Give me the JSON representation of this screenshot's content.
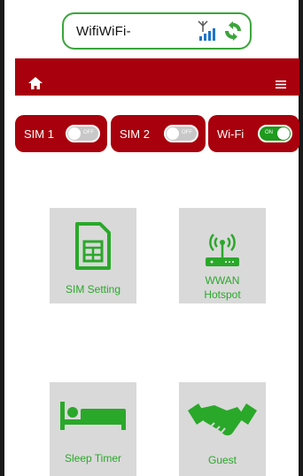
{
  "status": {
    "ssid": "WifiWiFi-"
  },
  "header": {
    "home_icon": "home-icon",
    "menu_icon": "hamburger-menu-icon"
  },
  "toggles": [
    {
      "label": "SIM 1",
      "state": "OFF"
    },
    {
      "label": "SIM 2",
      "state": "OFF"
    },
    {
      "label": "Wi-Fi",
      "state": "ON"
    }
  ],
  "tiles": [
    {
      "label": "SIM Setting",
      "icon": "sim-card-icon"
    },
    {
      "label": "WWAN Hotspot",
      "line1": "WWAN",
      "line2": "Hotspot",
      "icon": "router-icon"
    },
    {
      "label": "Sleep Timer",
      "icon": "bed-icon"
    },
    {
      "label": "Guest",
      "icon": "handshake-icon"
    }
  ],
  "colors": {
    "brand_red": "#a8000c",
    "accent_green": "#2aa82a",
    "tile_gray": "#d9d9d9"
  }
}
